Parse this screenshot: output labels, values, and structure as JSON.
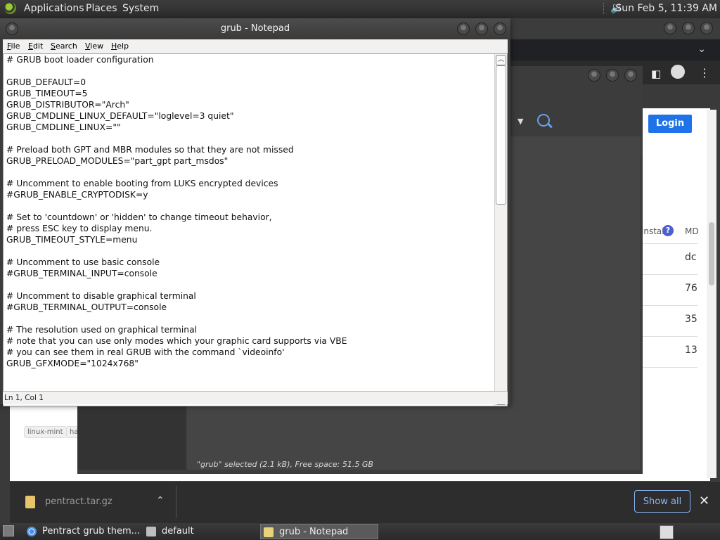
{
  "top_panel": {
    "menus": [
      "Applications",
      "Places",
      "System"
    ],
    "clock": "Sun Feb  5, 11:39 AM"
  },
  "browser": {
    "login_label": "Login",
    "column_header": "install",
    "column_header_2": "MD",
    "cells": [
      "dc",
      "76",
      "35",
      "13"
    ],
    "tags": [
      "linux-mint",
      "ha"
    ]
  },
  "file_manager": {
    "status": "\"grub\" selected (2.1 kB), Free space: 51.5 GB"
  },
  "notepad": {
    "title": "grub - Notepad",
    "menu": [
      "File",
      "Edit",
      "Search",
      "View",
      "Help"
    ],
    "content": "# GRUB boot loader configuration\n\nGRUB_DEFAULT=0\nGRUB_TIMEOUT=5\nGRUB_DISTRIBUTOR=\"Arch\"\nGRUB_CMDLINE_LINUX_DEFAULT=\"loglevel=3 quiet\"\nGRUB_CMDLINE_LINUX=\"\"\n\n# Preload both GPT and MBR modules so that they are not missed\nGRUB_PRELOAD_MODULES=\"part_gpt part_msdos\"\n\n# Uncomment to enable booting from LUKS encrypted devices\n#GRUB_ENABLE_CRYPTODISK=y\n\n# Set to 'countdown' or 'hidden' to change timeout behavior,\n# press ESC key to display menu.\nGRUB_TIMEOUT_STYLE=menu\n\n# Uncomment to use basic console\n#GRUB_TERMINAL_INPUT=console\n\n# Uncomment to disable graphical terminal\n#GRUB_TERMINAL_OUTPUT=console\n\n# The resolution used on graphical terminal\n# note that you can use only modes which your graphic card supports via VBE\n# you can see them in real GRUB with the command `videoinfo'\nGRUB_GFXMODE=\"1024x768\"",
    "status": "Ln 1, Col 1"
  },
  "download_bar": {
    "filename": "pentract.tar.gz",
    "show_all": "Show all"
  },
  "taskbar": {
    "tasks": [
      "Pentract grub them...",
      "default",
      "grub - Notepad"
    ]
  }
}
